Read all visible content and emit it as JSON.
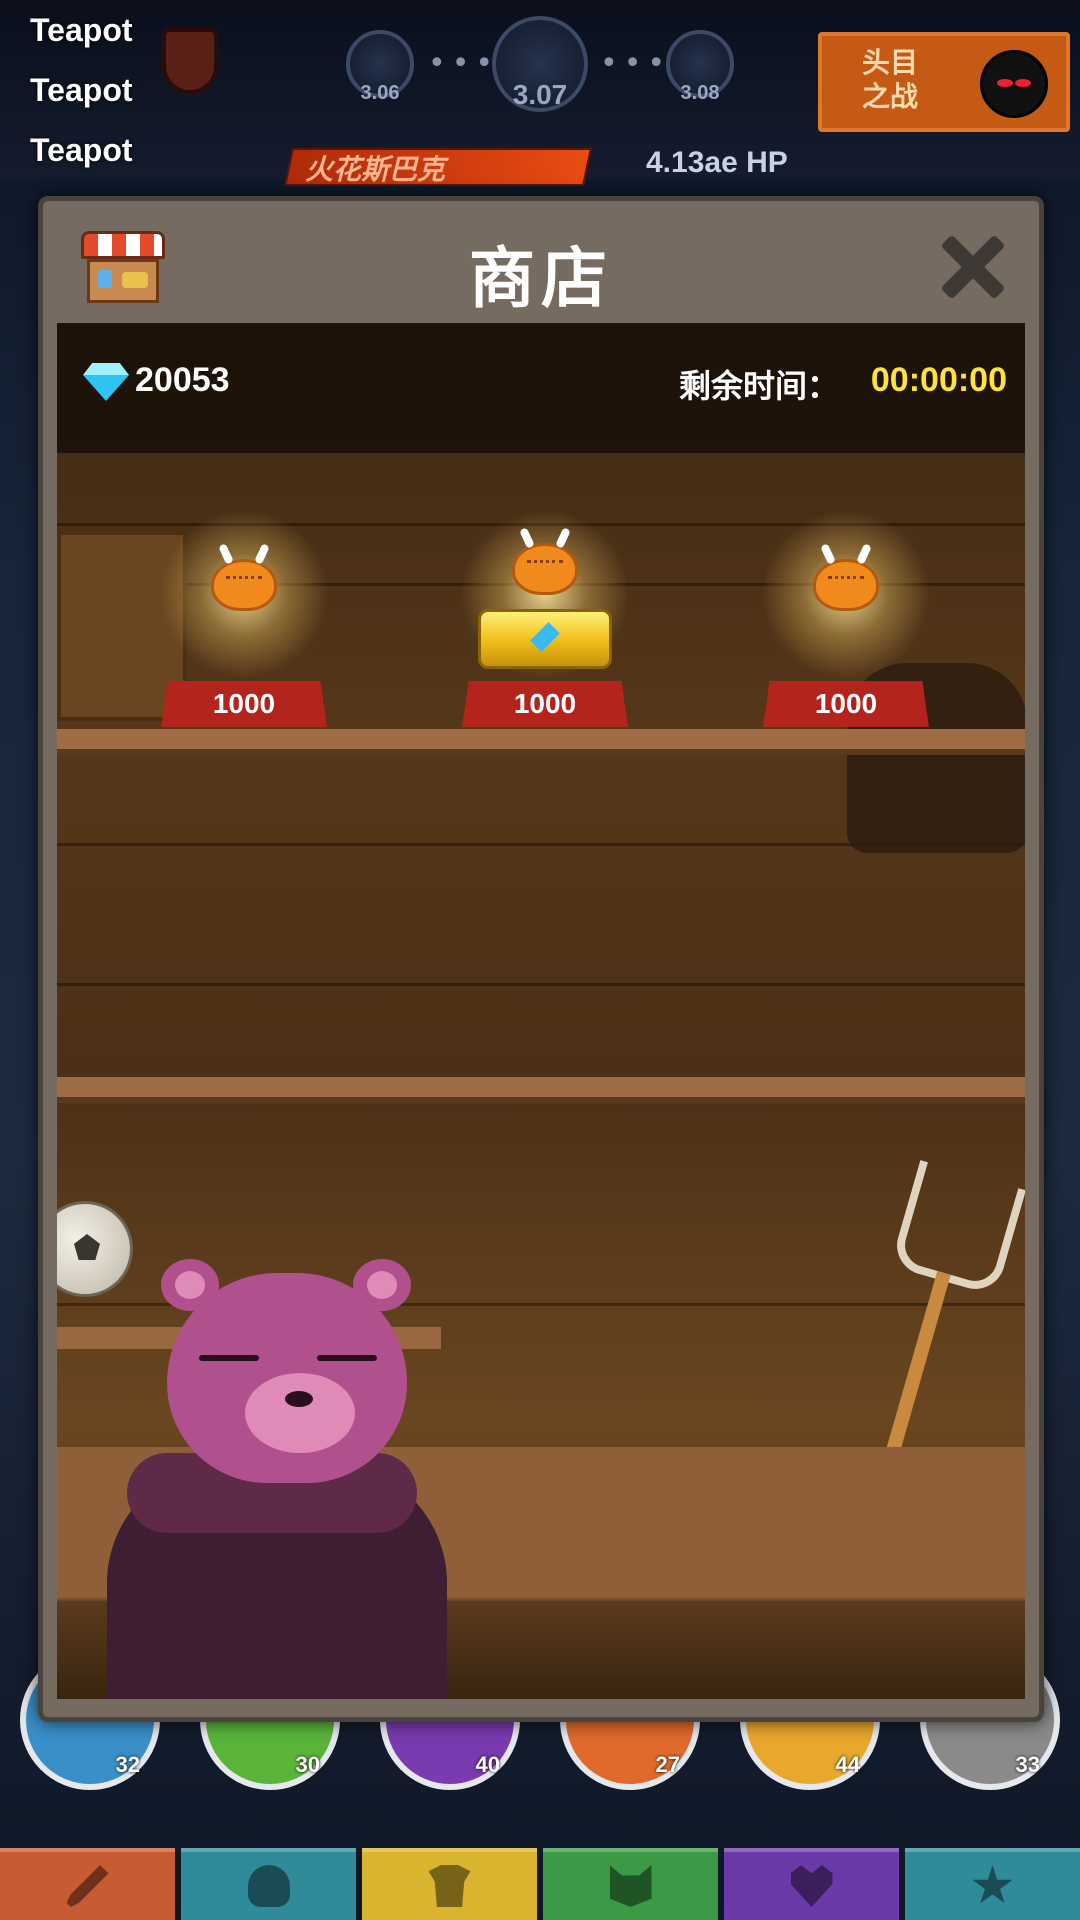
{
  "debug": {
    "lines": [
      "Teapot",
      "Teapot",
      "Teapot"
    ]
  },
  "stages": {
    "prev": "3.06",
    "current": "3.07",
    "next": "3.08"
  },
  "boss_fight": {
    "line1": "头目",
    "line2": "之战"
  },
  "boss": {
    "name": "火花斯巴克",
    "hp": "4.13ae HP"
  },
  "shop": {
    "title": "商店",
    "gems": "20053",
    "timer_label": "剩余时间：",
    "timer_value": "00:00:00",
    "items": [
      {
        "icon": "roast-chicken-icon",
        "price": "1000"
      },
      {
        "icon": "roast-chicken-icon",
        "extra_icon": "gold-chest-icon",
        "price": "1000"
      },
      {
        "icon": "roast-chicken-icon",
        "price": "1000"
      }
    ]
  },
  "skills": [
    "32",
    "30",
    "40",
    "27",
    "44",
    "33"
  ],
  "colors": {
    "modal_frame": "#756b61",
    "price_tag": "#b3241c",
    "timer": "#ffe23a",
    "tabs": [
      "#c85a34",
      "#2f8a9a",
      "#d8b52c",
      "#3a9a46",
      "#6a3aa8",
      "#2f8a9a"
    ],
    "skill_fills": [
      "#3a8fc8",
      "#5ab43a",
      "#7a3ab0",
      "#e06a2c",
      "#e8a82c",
      "#8a8a8a"
    ]
  },
  "tabs": [
    "sword-icon",
    "viking-helmet-icon",
    "shirt-icon",
    "cat-head-icon",
    "heart-icon",
    "star-icon"
  ]
}
